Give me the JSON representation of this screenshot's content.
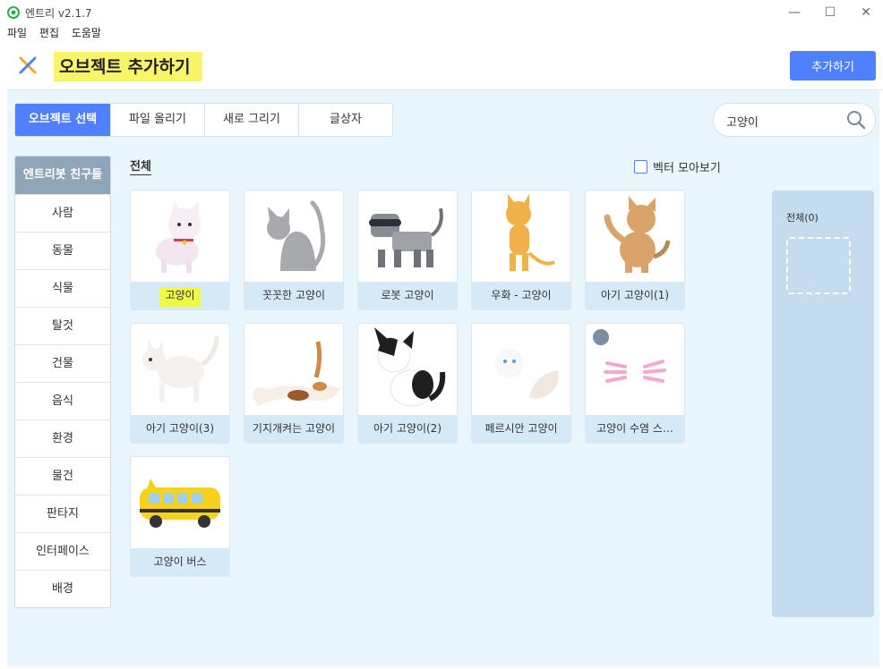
{
  "window": {
    "title": "엔트리 v2.1.7",
    "menu": [
      "파일",
      "편집",
      "도움말"
    ],
    "controls": {
      "minimize": "—",
      "maximize": "☐",
      "close": "✕"
    }
  },
  "header": {
    "title": "오브젝트 추가하기",
    "add_label": "추가하기",
    "close_icon": "close-x-icon"
  },
  "tabs": [
    {
      "label": "오브젝트 선택",
      "active": true
    },
    {
      "label": "파일 올리기",
      "active": false
    },
    {
      "label": "새로 그리기",
      "active": false
    },
    {
      "label": "글상자",
      "active": false
    }
  ],
  "search": {
    "value": "고양이",
    "placeholder": ""
  },
  "sidebar": {
    "header": "엔트리봇 친구들",
    "items": [
      "사람",
      "동물",
      "식물",
      "탈것",
      "건물",
      "음식",
      "환경",
      "물건",
      "판타지",
      "인터페이스",
      "배경"
    ]
  },
  "content": {
    "section_title": "전체",
    "vector_label": "벡터 모아보기",
    "vector_checked": false,
    "cards": [
      {
        "label": "고양이",
        "icon": "white-cat"
      },
      {
        "label": "꼿꼿한 고양이",
        "icon": "gray-cat"
      },
      {
        "label": "로봇 고양이",
        "icon": "robot-cat"
      },
      {
        "label": "우화 - 고양이",
        "icon": "standing-cat"
      },
      {
        "label": "아기 고양이(1)",
        "icon": "kitten-1"
      },
      {
        "label": "아기 고양이(3)",
        "icon": "kitten-3"
      },
      {
        "label": "기지개켜는 고양이",
        "icon": "stretching-cat"
      },
      {
        "label": "아기 고양이(2)",
        "icon": "kitten-2"
      },
      {
        "label": "페르시안 고양이",
        "icon": "persian-cat"
      },
      {
        "label": "고양이 수염 스…",
        "icon": "whisker-sticker"
      },
      {
        "label": "고양이 버스",
        "icon": "cat-bus"
      }
    ]
  },
  "panel": {
    "title": "전체(0)"
  },
  "colors": {
    "accent": "#4f80ff",
    "highlight": "#f9f56a",
    "bg": "#e9f6fd"
  }
}
